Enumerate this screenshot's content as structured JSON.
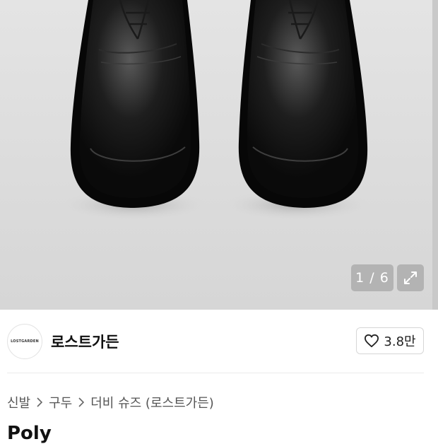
{
  "gallery": {
    "current_page": "1",
    "total_pages": "6",
    "pager_text": "1 / 6",
    "background_color": "#dcdcdc"
  },
  "store": {
    "logo_text": "LOSTGARDEN",
    "name": "로스트가든",
    "like_count": "3.8만"
  },
  "breadcrumb": {
    "items": [
      "신발",
      "구두",
      "더비 슈즈 (로스트가든)"
    ]
  },
  "product": {
    "title": "Poly"
  },
  "icons": {
    "like": "heart-outline-icon",
    "expand": "expand-arrows-icon",
    "separator": "chevron-right-icon"
  },
  "colors": {
    "accent": "#111111",
    "muted_text": "#555555",
    "border": "#d6d6d6"
  }
}
